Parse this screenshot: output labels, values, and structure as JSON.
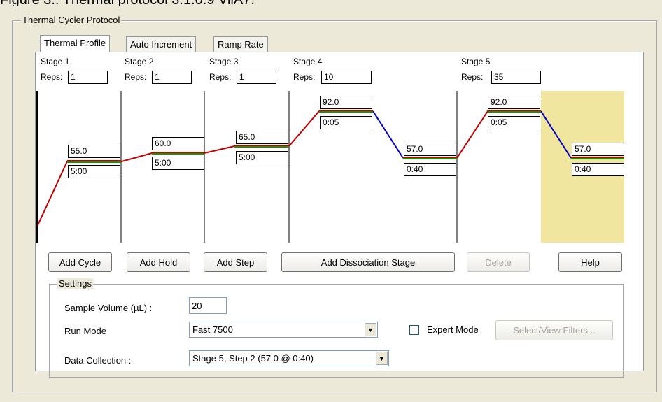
{
  "caption": "Figure 3.: Thermal protocol 3.1.0.9 ViiA7.",
  "group_title": "Thermal Cycler Protocol",
  "tabs": [
    {
      "label": "Thermal Profile",
      "active": true
    },
    {
      "label": "Auto Increment",
      "active": false
    },
    {
      "label": "Ramp Rate",
      "active": false
    }
  ],
  "reps_label": "Reps:",
  "stages": [
    {
      "label": "Stage 1",
      "reps": "1"
    },
    {
      "label": "Stage 2",
      "reps": "1"
    },
    {
      "label": "Stage 3",
      "reps": "1"
    },
    {
      "label": "Stage 4",
      "reps": "10"
    },
    {
      "label": "Stage 5",
      "reps": "35"
    }
  ],
  "steps": [
    {
      "temp": "55.0",
      "time": "5:00"
    },
    {
      "temp": "60.0",
      "time": "5:00"
    },
    {
      "temp": "65.0",
      "time": "5:00"
    },
    {
      "temp": "92.0",
      "time": "0:05"
    },
    {
      "temp": "57.0",
      "time": "0:40"
    },
    {
      "temp": "92.0",
      "time": "0:05"
    },
    {
      "temp": "57.0",
      "time": "0:40"
    }
  ],
  "buttons": {
    "add_cycle": "Add Cycle",
    "add_hold": "Add Hold",
    "add_step": "Add Step",
    "add_dissociation": "Add Dissociation Stage",
    "delete": "Delete",
    "help": "Help"
  },
  "settings": {
    "title": "Settings",
    "sample_volume_label": "Sample Volume (µL) :",
    "sample_volume_value": "20",
    "run_mode_label": "Run Mode",
    "run_mode_value": "Fast 7500",
    "expert_mode_label": "Expert Mode",
    "expert_mode_checked": false,
    "select_filters_label": "Select/View Filters...",
    "data_collection_label": "Data Collection :",
    "data_collection_value": "Stage 5, Step 2 (57.0 @ 0:40)"
  },
  "colors": {
    "ramp_up": "#c00000",
    "ramp_down": "#0000c0",
    "hold": "#00a000",
    "selected_step": "#f0e6a0"
  }
}
